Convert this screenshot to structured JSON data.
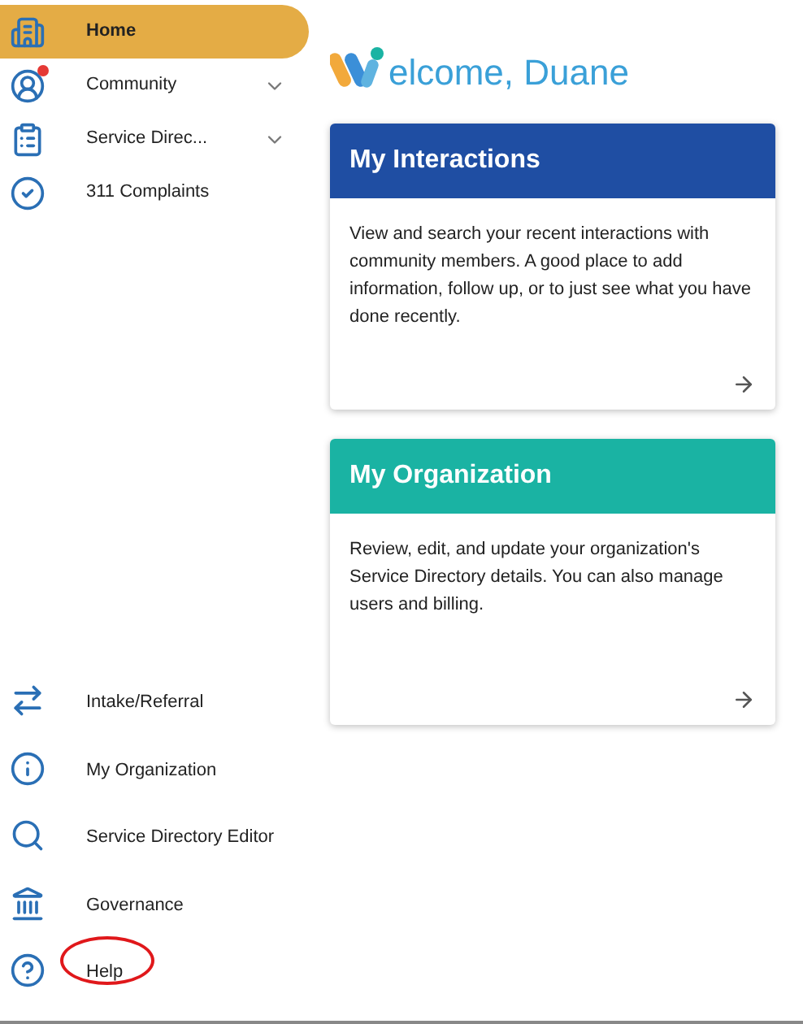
{
  "sidebar": {
    "top_items": [
      {
        "label": "Home",
        "selected": true,
        "expandable": false,
        "notification": false
      },
      {
        "label": "Community",
        "selected": false,
        "expandable": true,
        "notification": true
      },
      {
        "label": "Service Direc...",
        "selected": false,
        "expandable": true,
        "notification": false
      },
      {
        "label": "311 Complaints",
        "selected": false,
        "expandable": false,
        "notification": false
      }
    ],
    "bottom_items": [
      {
        "label": "Intake/Referral",
        "selected": false,
        "annotated": false
      },
      {
        "label": "My Organization",
        "selected": false,
        "annotated": false
      },
      {
        "label": "Service Directory Editor",
        "selected": false,
        "annotated": false
      },
      {
        "label": "Governance",
        "selected": false,
        "annotated": false
      },
      {
        "label": "Help",
        "selected": false,
        "annotated": true
      }
    ]
  },
  "welcome": {
    "title": "elcome, Duane"
  },
  "cards": [
    {
      "title": "My Interactions",
      "color": "#1f4ea3",
      "body": "View and search your recent interactions with community members. A good place to add information, follow up, or to just see what you have done recently."
    },
    {
      "title": "My Organization",
      "color": "#1ab3a3",
      "body": "Review, edit, and update your organization's Service Directory details. You can also manage users and billing."
    }
  ]
}
